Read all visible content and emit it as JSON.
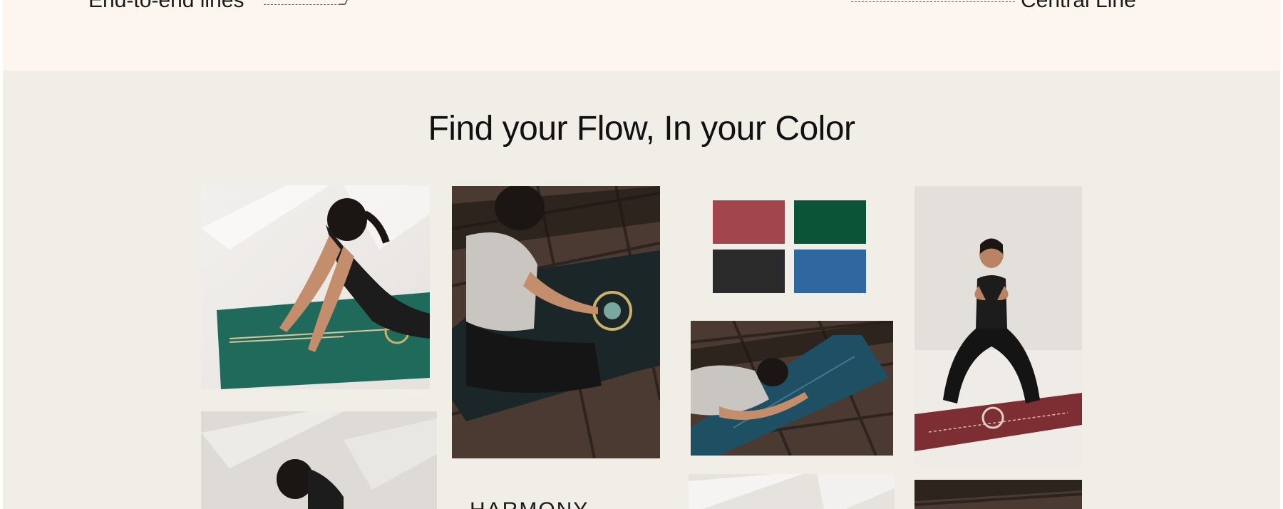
{
  "features": {
    "left_label": "End-to-end lines",
    "right_label": "Central Line"
  },
  "gallery": {
    "heading": "Find your Flow, In your Color",
    "caption": "HARMONY",
    "swatches": [
      {
        "name": "red",
        "color": "#a3464c"
      },
      {
        "name": "green",
        "color": "#0b5437"
      },
      {
        "name": "black",
        "color": "#2a2a2a"
      },
      {
        "name": "blue",
        "color": "#2f689f"
      }
    ],
    "photos": [
      {
        "description": "woman-on-green-mat"
      },
      {
        "description": "woman-seated-on-black-mat"
      },
      {
        "description": "woman-stretching-on-blue-mat"
      },
      {
        "description": "woman-squat-on-maroon-mat"
      },
      {
        "description": "woman-bending-on-mat"
      },
      {
        "description": "light-room-photo"
      },
      {
        "description": "wooden-deck-photo"
      }
    ]
  }
}
